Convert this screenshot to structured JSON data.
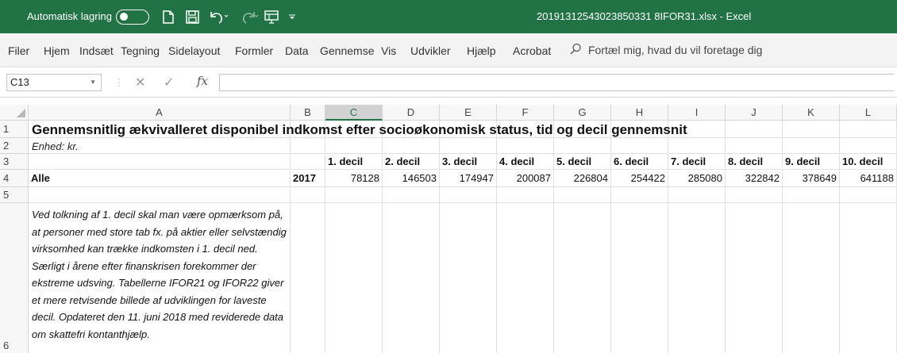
{
  "titlebar": {
    "autosave_label": "Automatisk lagring",
    "filename": "20191312543023850331 8IFOR31.xlsx  -  Excel",
    "icons": [
      "toggle-off-icon",
      "new-file-icon",
      "save-icon",
      "undo-icon",
      "redo-icon",
      "touch-mode-icon",
      "customize-qat-icon"
    ]
  },
  "menu": {
    "items": [
      "Filer",
      "Hjem",
      "Indsæt",
      "Tegning",
      "Sidelayout",
      "Formler",
      "Data",
      "Gennemse",
      "Vis",
      "Udvikler",
      "Hjælp",
      "Acrobat"
    ],
    "search_text": "Fortæl mig, hvad du vil foretage dig"
  },
  "formulabar": {
    "namebox": "C13",
    "fx": "fx",
    "formula": ""
  },
  "sheet": {
    "columns": [
      "A",
      "B",
      "C",
      "D",
      "E",
      "F",
      "G",
      "H",
      "I",
      "J",
      "K",
      "L"
    ],
    "selected_column": "C",
    "rows": [
      "1",
      "2",
      "3",
      "4",
      "5",
      "6"
    ],
    "title": "Gennemsnitlig ækvivalleret disponibel indkomst efter socioøkonomisk status, tid og decil gennemsnit",
    "unit": "Enhed: kr.",
    "decile_headers": [
      "1. decil",
      "2. decil",
      "3. decil",
      "4. decil",
      "5. decil",
      "6. decil",
      "7. decil",
      "8. decil",
      "9. decil",
      "10. decil"
    ],
    "row4_label": "Alle",
    "row4_year": "2017",
    "row4_values": [
      "78128",
      "146503",
      "174947",
      "200087",
      "226804",
      "254422",
      "285080",
      "322842",
      "378649",
      "641188"
    ],
    "note": "Ved tolkning af 1. decil skal man være opmærksom på, at personer med store tab fx. på aktier eller selvstændig virksomhed kan trække indkomsten i 1. decil ned. Særligt i årene efter finanskrisen forekommer der ekstreme udsving. Tabellerne IFOR21 og IFOR22 giver et mere retvisende billede af udviklingen for laveste decil. Opdateret den 11. juni 2018 med reviderede data om skattefri kontanthjælp."
  },
  "colors": {
    "excel_green": "#217346",
    "menu_bg": "#f3f3f3",
    "header_bg": "#f7f7f7"
  }
}
